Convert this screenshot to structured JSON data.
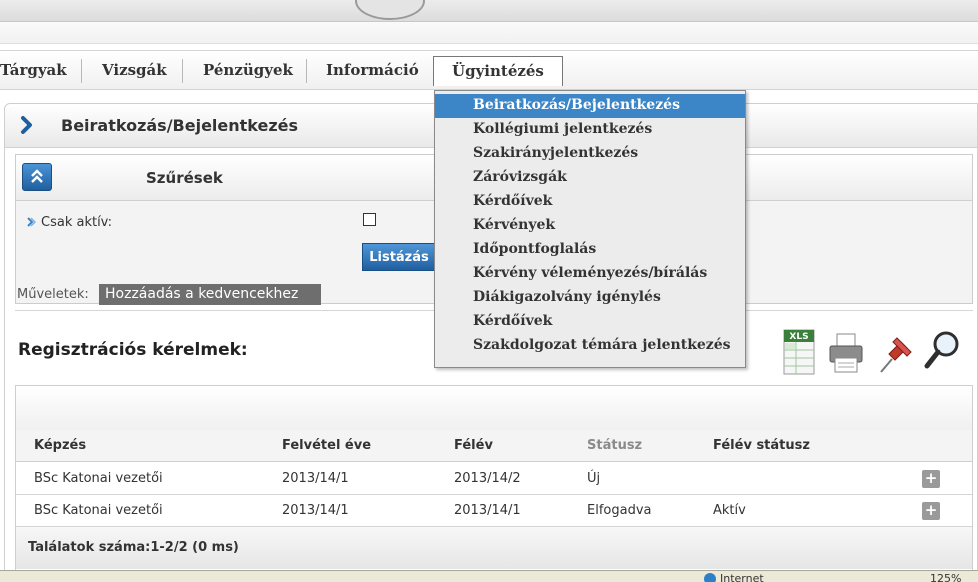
{
  "menu": {
    "items": [
      {
        "label": "Tárgyak"
      },
      {
        "label": "Vizsgák"
      },
      {
        "label": "Pénzügyek"
      },
      {
        "label": "Információ"
      },
      {
        "label": "Ügyintézés"
      }
    ],
    "active_index": 4
  },
  "dropdown": {
    "items": [
      "Beiratkozás/Bejelentkezés",
      "Kollégiumi jelentkezés",
      "Szakirányjelentkezés",
      "Záróvizsgák",
      "Kérdőívek",
      "Kérvények",
      "Időpontfoglalás",
      "Kérvény véleményezés/bírálás",
      "Diákigazolvány igénylés",
      "Kérdőívek",
      "Szakdolgozat témára jelentkezés"
    ],
    "selected_index": 0
  },
  "panel": {
    "title": "Beiratkozás/Bejelentkezés"
  },
  "filter": {
    "title": "Szűrések",
    "only_active_label": "Csak aktív:",
    "only_active_checked": false,
    "list_button": "Listázás"
  },
  "operations": {
    "label": "Műveletek:",
    "add_favorite": "Hozzáadás a kedvencekhez"
  },
  "section": {
    "title": "Regisztrációs kérelmek:"
  },
  "toolbar": {
    "xls_label": "XLS",
    "icons": [
      "xls-export-icon",
      "print-icon",
      "pin-icon",
      "search-icon"
    ]
  },
  "grid": {
    "columns": [
      "Képzés",
      "Felvétel éve",
      "Félév",
      "Státusz",
      "Félév státusz"
    ],
    "rows": [
      {
        "kepzes": "BSc Katonai vezetői",
        "felvetel": "2013/14/1",
        "felev": "2013/14/2",
        "statusz": "Új",
        "felev_statusz": ""
      },
      {
        "kepzes": "BSc Katonai vezetői",
        "felvetel": "2013/14/1",
        "felev": "2013/14/1",
        "statusz": "Elfogadva",
        "felev_statusz": "Aktív"
      }
    ],
    "plus_symbol": "+",
    "footer": "Találatok száma:1-2/2 (0 ms)"
  },
  "statusbar": {
    "zone": "Internet",
    "zoom": "125%"
  },
  "colors": {
    "accent_blue": "#3c86c8",
    "button_dark": "#6e6e6e"
  }
}
